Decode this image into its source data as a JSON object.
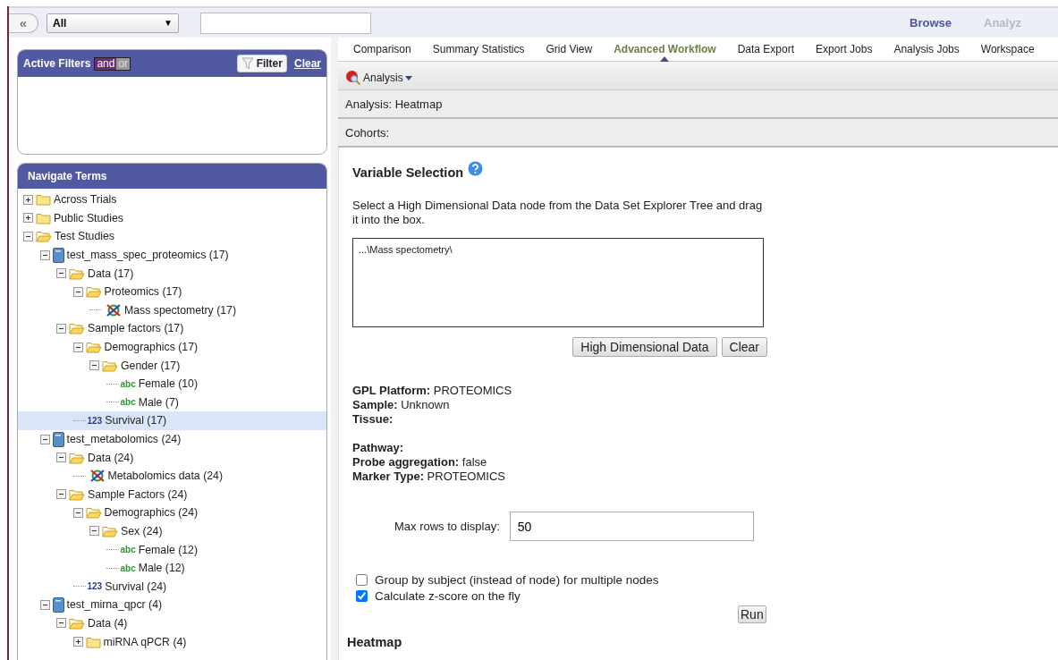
{
  "top_bar": {
    "collapse_button": "«",
    "filter_select": {
      "value": "All",
      "arrow": "▼"
    },
    "nav_links": [
      {
        "label": "Browse",
        "selected": true
      },
      {
        "label": "Analyz",
        "selected": false
      }
    ]
  },
  "active_filters": {
    "title": "Active Filters",
    "operators": [
      {
        "label": "and",
        "selected": true
      },
      {
        "label": "or",
        "selected": false
      }
    ],
    "filter_button": "Filter",
    "clear_link": "Clear"
  },
  "navigate_terms": {
    "title": "Navigate Terms",
    "tree": [
      {
        "label": "Across Trials",
        "kind": "folder",
        "expanded": false,
        "selected": false
      },
      {
        "label": "Public Studies",
        "kind": "folder",
        "expanded": false,
        "selected": false
      },
      {
        "label": "Test Studies",
        "kind": "folder",
        "expanded": true,
        "selected": false,
        "children": [
          {
            "label": "test_mass_spec_proteomics (17)",
            "kind": "study",
            "expanded": true,
            "selected": false,
            "children": [
              {
                "label": "Data (17)",
                "kind": "folder",
                "expanded": true,
                "selected": false,
                "children": [
                  {
                    "label": "Proteomics (17)",
                    "kind": "folder",
                    "expanded": true,
                    "selected": false,
                    "children": [
                      {
                        "label": "Mass spectometry (17)",
                        "kind": "highdim",
                        "selected": false
                      }
                    ]
                  }
                ]
              },
              {
                "label": "Sample factors (17)",
                "kind": "folder",
                "expanded": true,
                "selected": false,
                "children": [
                  {
                    "label": "Demographics (17)",
                    "kind": "folder",
                    "expanded": true,
                    "selected": false,
                    "children": [
                      {
                        "label": "Gender (17)",
                        "kind": "folder",
                        "expanded": true,
                        "selected": false,
                        "children": [
                          {
                            "label": "Female (10)",
                            "kind": "text",
                            "badge": "abc",
                            "selected": false
                          },
                          {
                            "label": "Male (7)",
                            "kind": "text",
                            "badge": "abc",
                            "selected": false
                          }
                        ]
                      }
                    ]
                  },
                  {
                    "label": "Survival (17)",
                    "kind": "numeric",
                    "badge": "123",
                    "selected": true
                  }
                ]
              }
            ]
          },
          {
            "label": "test_metabolomics (24)",
            "kind": "study",
            "expanded": true,
            "selected": false,
            "children": [
              {
                "label": "Data (24)",
                "kind": "folder",
                "expanded": true,
                "selected": false,
                "children": [
                  {
                    "label": "Metabolomics data (24)",
                    "kind": "highdim",
                    "selected": false
                  }
                ]
              },
              {
                "label": "Sample Factors (24)",
                "kind": "folder",
                "expanded": true,
                "selected": false,
                "children": [
                  {
                    "label": "Demographics (24)",
                    "kind": "folder",
                    "expanded": true,
                    "selected": false,
                    "children": [
                      {
                        "label": "Sex (24)",
                        "kind": "folder",
                        "expanded": true,
                        "selected": false,
                        "children": [
                          {
                            "label": "Female (12)",
                            "kind": "text",
                            "badge": "abc",
                            "selected": false
                          },
                          {
                            "label": "Male (12)",
                            "kind": "text",
                            "badge": "abc",
                            "selected": false
                          }
                        ]
                      }
                    ]
                  },
                  {
                    "label": "Survival (24)",
                    "kind": "numeric",
                    "badge": "123",
                    "selected": false
                  }
                ]
              }
            ]
          },
          {
            "label": "test_mirna_qpcr (4)",
            "kind": "study",
            "expanded": true,
            "selected": false,
            "children": [
              {
                "label": "Data (4)",
                "kind": "folder",
                "expanded": true,
                "selected": false,
                "children": [
                  {
                    "label": "miRNA qPCR (4)",
                    "kind": "folder",
                    "expanded": false,
                    "selected": false
                  }
                ]
              }
            ]
          }
        ]
      }
    ]
  },
  "tabs": [
    {
      "label": "Comparison",
      "selected": false
    },
    {
      "label": "Summary Statistics",
      "selected": false
    },
    {
      "label": "Grid View",
      "selected": false
    },
    {
      "label": "Advanced Workflow",
      "selected": true
    },
    {
      "label": "Data Export",
      "selected": false
    },
    {
      "label": "Export Jobs",
      "selected": false
    },
    {
      "label": "Analysis Jobs",
      "selected": false
    },
    {
      "label": "Workspace",
      "selected": false
    }
  ],
  "toolbar": {
    "menu": "Analysis"
  },
  "analysis_label": "Analysis: Heatmap",
  "cohorts_label": "Cohorts:",
  "variable_selection": {
    "title": "Variable Selection",
    "instructions": "Select a High Dimensional Data node from the Data Set Explorer Tree and drag it into the box.",
    "drop_box_value": "...\\Mass spectometry\\",
    "buttons": [
      "High Dimensional Data",
      "Clear"
    ]
  },
  "info_groups": [
    [
      {
        "label": "GPL Platform:",
        "value": "PROTEOMICS"
      },
      {
        "label": "Sample:",
        "value": "Unknown"
      },
      {
        "label": "Tissue:"
      }
    ],
    [
      {
        "label": "Pathway:"
      },
      {
        "label": "Probe aggregation:",
        "value": "false"
      },
      {
        "label": "Marker Type:",
        "value": "PROTEOMICS"
      }
    ]
  ],
  "max_rows": {
    "label": "Max rows to display:",
    "value": "50"
  },
  "options": [
    {
      "label": "Group by subject (instead of node) for multiple nodes",
      "checked": false
    },
    {
      "label": "Calculate z-score on the fly",
      "checked": true
    }
  ],
  "run_button": "Run",
  "result_title": "Heatmap"
}
